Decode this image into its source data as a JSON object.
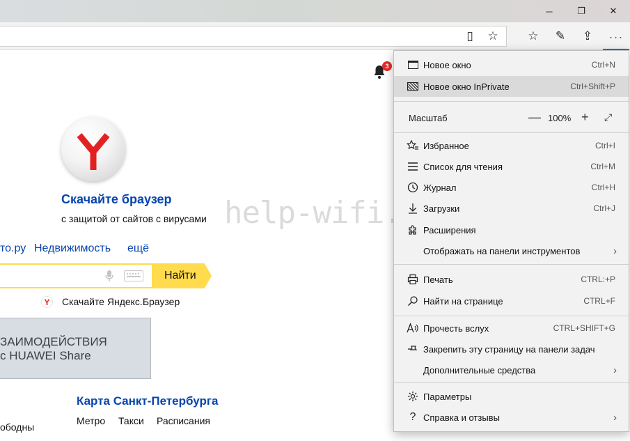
{
  "window": {
    "minimize_glyph": "─",
    "maximize_glyph": "❐",
    "close_glyph": "✕"
  },
  "toolbar": {
    "reading_view_glyph": "▯",
    "favorite_star_glyph": "☆",
    "favorites_hub_glyph": "☆",
    "pen_glyph": "✎",
    "share_glyph": "⇪",
    "more_glyph": "···"
  },
  "page": {
    "notification_count": "3",
    "promo_title": "Скачайте браузер",
    "promo_subtitle": "с защитой от сайтов с вирусами",
    "watermark": "help-wifi.ru",
    "nav_links": [
      "то.ру",
      "Недвижимость",
      "ещё"
    ],
    "search_button": "Найти",
    "download_browser": "Скачайте Яндекс.Браузер",
    "banner_line1": "ЗАИМОДЕЙСТВИЯ",
    "banner_line2": "с HUAWEI Share",
    "map_title": "Карта Санкт-Петербурга",
    "map_links": [
      "Метро",
      "Такси",
      "Расписания"
    ],
    "cut_text": "ободны"
  },
  "menu": {
    "new_window": {
      "label": "Новое окно",
      "shortcut": "Ctrl+N"
    },
    "new_private": {
      "label": "Новое окно InPrivate",
      "shortcut": "Ctrl+Shift+P"
    },
    "zoom": {
      "label": "Масштаб",
      "value": "100%",
      "minus": "—",
      "plus": "+",
      "fullscreen": "⤢"
    },
    "favorites": {
      "label": "Избранное",
      "shortcut": "Ctrl+I"
    },
    "reading_list": {
      "label": "Список для чтения",
      "shortcut": "Ctrl+M"
    },
    "history": {
      "label": "Журнал",
      "shortcut": "Ctrl+H"
    },
    "downloads": {
      "label": "Загрузки",
      "shortcut": "Ctrl+J"
    },
    "extensions": {
      "label": "Расширения"
    },
    "show_in_toolbar": {
      "label": "Отображать на панели инструментов"
    },
    "print": {
      "label": "Печать",
      "shortcut": "CTRL:+P"
    },
    "find": {
      "label": "Найти на странице",
      "shortcut": "CTRL+F"
    },
    "read_aloud": {
      "label": "Прочесть вслух",
      "shortcut": "CTRL+SHIFT+G"
    },
    "pin": {
      "label": "Закрепить эту страницу на панели задач"
    },
    "more_tools": {
      "label": "Дополнительные средства"
    },
    "settings": {
      "label": "Параметры"
    },
    "help": {
      "label": "Справка и отзывы"
    }
  },
  "icons": {
    "bell": "bell-icon",
    "favorites": "star-list-icon",
    "reading_list": "lines-icon",
    "history": "clock-icon",
    "downloads": "arrow-down-icon",
    "extensions": "puzzle-icon",
    "print": "printer-icon",
    "find": "magnifier-icon",
    "read_aloud": "speaker-letter-icon",
    "pin": "pin-icon",
    "settings": "gear-icon",
    "help": "question-icon"
  },
  "colors": {
    "link": "#0645ad",
    "search_accent": "#ffdb4d",
    "edge_accent": "#0078d7",
    "badge": "#e52b2b",
    "yandex_red": "#e22222"
  }
}
